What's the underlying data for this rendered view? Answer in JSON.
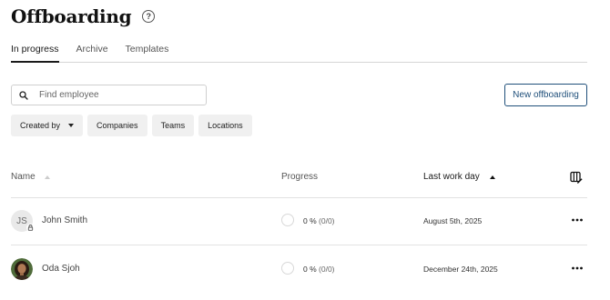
{
  "header": {
    "title": "Offboarding",
    "help_icon": "question-circle-icon"
  },
  "tabs": [
    {
      "label": "In progress",
      "active": true
    },
    {
      "label": "Archive",
      "active": false
    },
    {
      "label": "Templates",
      "active": false
    }
  ],
  "search": {
    "placeholder": "Find employee",
    "value": ""
  },
  "actions": {
    "new_label": "New offboarding"
  },
  "filters": [
    {
      "label": "Created by",
      "dropdown": true
    },
    {
      "label": "Companies"
    },
    {
      "label": "Teams"
    },
    {
      "label": "Locations"
    }
  ],
  "table": {
    "columns": {
      "name": "Name",
      "progress": "Progress",
      "last_work_day": "Last work day"
    },
    "sort": {
      "column": "last_work_day",
      "direction": "ascending"
    },
    "rows": [
      {
        "initials": "JS",
        "name": "John Smith",
        "avatar": "initials",
        "locked": true,
        "progress_pct": "0 %",
        "progress_frac": "(0/0)",
        "last_work_day": "August 5th, 2025"
      },
      {
        "initials": "",
        "name": "Oda Sjoh",
        "avatar": "photo",
        "locked": false,
        "progress_pct": "0 %",
        "progress_frac": "(0/0)",
        "last_work_day": "December 24th, 2025"
      }
    ]
  },
  "colors": {
    "accent": "#1f4f7a",
    "chip_bg": "#f0f0f0",
    "divider": "#e2e2e2"
  }
}
